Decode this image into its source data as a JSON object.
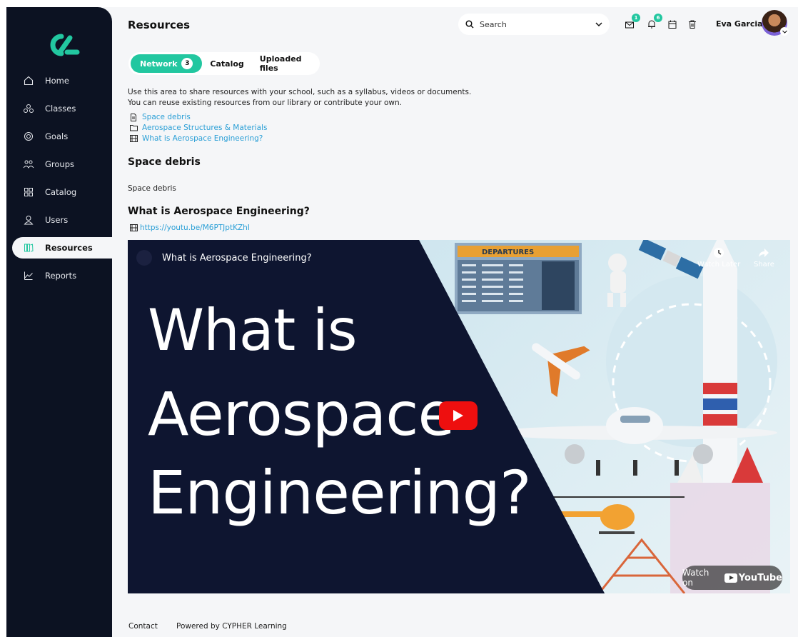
{
  "header": {
    "title": "Resources",
    "search_label": "Search",
    "notifications": {
      "messages": "1",
      "alerts": "6"
    },
    "user_name": "Eva Garcia"
  },
  "sidebar": {
    "items": [
      {
        "label": "Home",
        "icon": "home-icon"
      },
      {
        "label": "Classes",
        "icon": "classes-icon"
      },
      {
        "label": "Goals",
        "icon": "goals-icon"
      },
      {
        "label": "Groups",
        "icon": "groups-icon"
      },
      {
        "label": "Catalog",
        "icon": "catalog-icon"
      },
      {
        "label": "Users",
        "icon": "users-icon"
      },
      {
        "label": "Resources",
        "icon": "resources-icon",
        "active": true
      },
      {
        "label": "Reports",
        "icon": "reports-icon"
      }
    ]
  },
  "tabs": [
    {
      "label": "Network",
      "count": "3",
      "active": true
    },
    {
      "label": "Catalog"
    },
    {
      "label": "Uploaded files"
    }
  ],
  "intro": {
    "line1": "Use this area to share resources with your school, such as a syllabus, videos or documents.",
    "line2": "You can reuse existing resources from our library or contribute your own."
  },
  "resources": [
    {
      "label": "Space debris",
      "icon": "document-icon"
    },
    {
      "label": "Aerospace Structures & Materials",
      "icon": "folder-icon"
    },
    {
      "label": "What is Aerospace Engineering?",
      "icon": "film-icon"
    }
  ],
  "sections": {
    "debris_title": "Space debris",
    "debris_body": "Space debris",
    "video_title": "What is Aerospace Engineering?",
    "video_url": "https://youtu.be/M6PTJptKZhI"
  },
  "video": {
    "title": "What is Aerospace Engineering?",
    "big_line1": "What is",
    "big_line2": "Aerospace",
    "big_line3": "Engineering?",
    "departures": "DEPARTURES",
    "watch_later": "Watch Later",
    "share": "Share",
    "watch_on": "Watch on",
    "youtube": "YouTube"
  },
  "footer": {
    "contact": "Contact",
    "powered": "Powered by CYPHER Learning"
  },
  "colors": {
    "accent": "#22c7a0",
    "sidebar": "#0c1222",
    "link": "#2a9fd6",
    "play": "#ee0f0f"
  }
}
